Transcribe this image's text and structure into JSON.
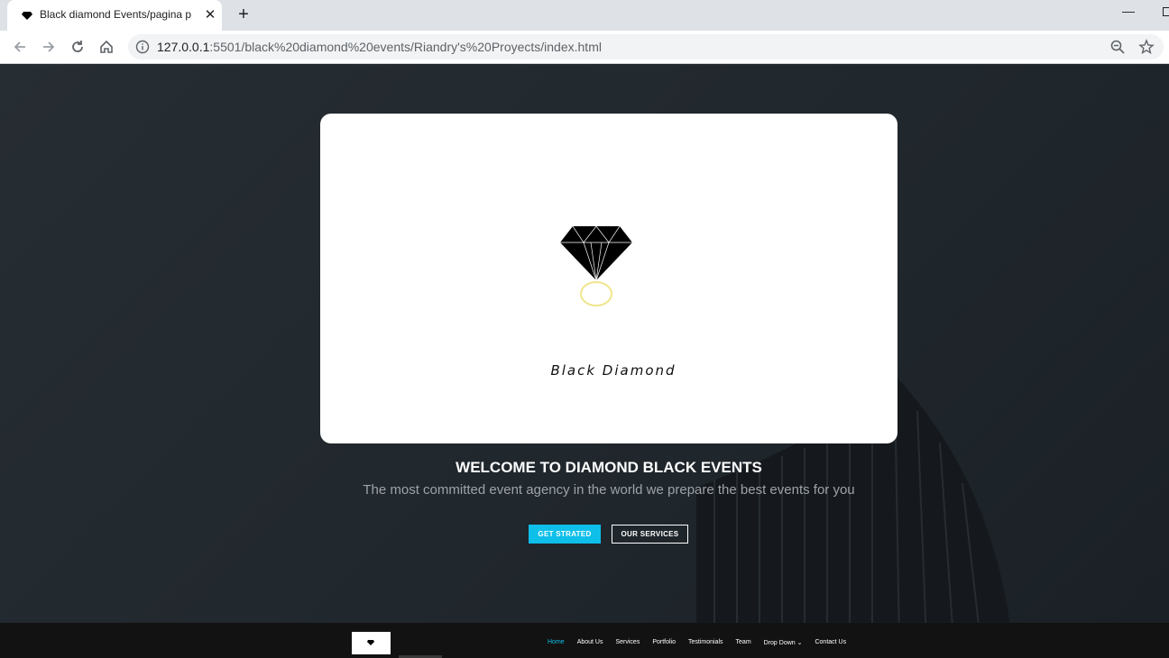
{
  "browser": {
    "tab_title": "Black diamond Events/pagina principal",
    "tab_close": "✕",
    "new_tab": "+",
    "url_host": "127.0.0.1",
    "url_rest": ":5501/black%20diamond%20events/Riandry's%20Proyects/index.html",
    "minimize": "—"
  },
  "hero": {
    "brand_text": "Black Diamond",
    "welcome_title": "WELCOME TO DIAMOND BLACK EVENTS",
    "tagline": "The most committed event agency in the world we prepare the best events for you",
    "cta_primary": "GET STRATED",
    "cta_secondary": "OUR SERVICES"
  },
  "navbar": {
    "items": [
      "Home",
      "About Us",
      "Services",
      "Portfolio",
      "Testimonials",
      "Team",
      "Drop Down ⌄",
      "Contact Us"
    ],
    "active_index": 0
  },
  "colors": {
    "accent": "#0ebfe9",
    "hero_bg": "#20272d",
    "navbar_bg": "#121212",
    "ring_gold": "#f0e68c"
  },
  "icons": {
    "back": "arrow-left-icon",
    "forward": "arrow-right-icon",
    "reload": "reload-icon",
    "home": "home-icon",
    "info": "info-icon",
    "zoom": "zoom-out-icon",
    "bookmark": "star-icon"
  }
}
